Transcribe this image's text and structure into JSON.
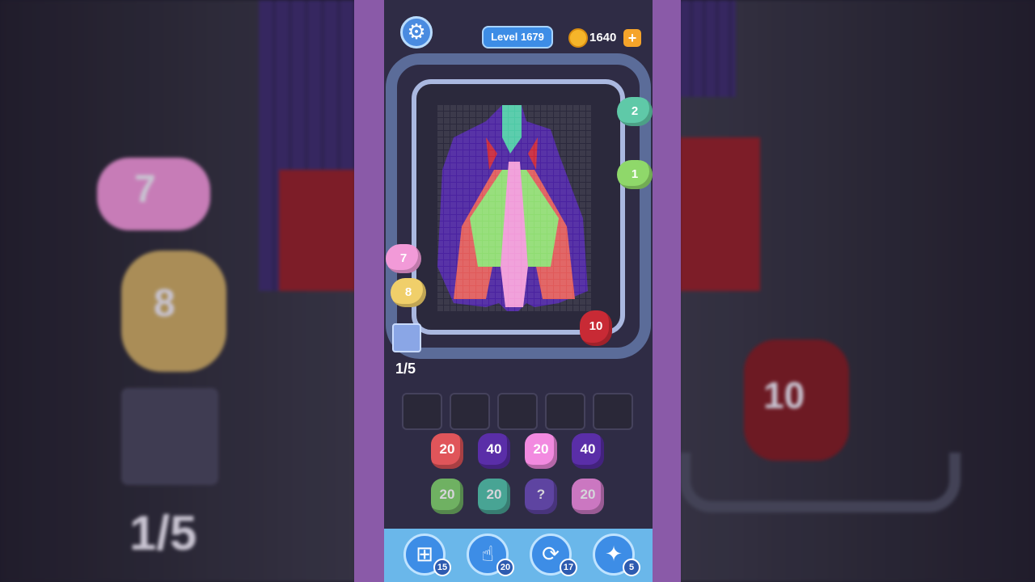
{
  "header": {
    "level_label": "Level 1679",
    "coins": "1640",
    "coin_plus": "+"
  },
  "progress": "1/5",
  "track_pigs": [
    {
      "label": "2",
      "color": "#5fc9a8"
    },
    {
      "label": "1",
      "color": "#8fd86a"
    },
    {
      "label": "7",
      "color": "#f29ad8"
    },
    {
      "label": "8",
      "color": "#f0cf6a"
    },
    {
      "label": "10",
      "color": "#c82a35"
    }
  ],
  "queue": [
    [
      {
        "label": "20",
        "color": "#e0555a"
      },
      {
        "label": "40",
        "color": "#5a2ea8"
      },
      {
        "label": "20",
        "color": "#f28ae0"
      },
      {
        "label": "40",
        "color": "#5a2ea8"
      }
    ],
    [
      {
        "label": "20",
        "color": "#7fd36a"
      },
      {
        "label": "20",
        "color": "#4fc3a8"
      },
      {
        "label": "?",
        "color": "#6a4ab8"
      },
      {
        "label": "20",
        "color": "#f28ae0"
      }
    ]
  ],
  "tools": [
    {
      "icon": "add-box-icon",
      "glyph": "⊞",
      "count": "15"
    },
    {
      "icon": "hand-tap-icon",
      "glyph": "☝",
      "count": "20"
    },
    {
      "icon": "shuffle-icon",
      "glyph": "⟳",
      "count": "17"
    },
    {
      "icon": "magnet-icon",
      "glyph": "✦",
      "count": "5"
    }
  ],
  "background": {
    "left_pig_a": "7",
    "left_pig_b": "8",
    "left_progress": "1/5",
    "right_pig": "10"
  },
  "colors": {
    "frame": "#8a5aa8",
    "phone_bg": "#2f2c45",
    "track": "#5b6c99",
    "accent_blue": "#3d8de6"
  }
}
